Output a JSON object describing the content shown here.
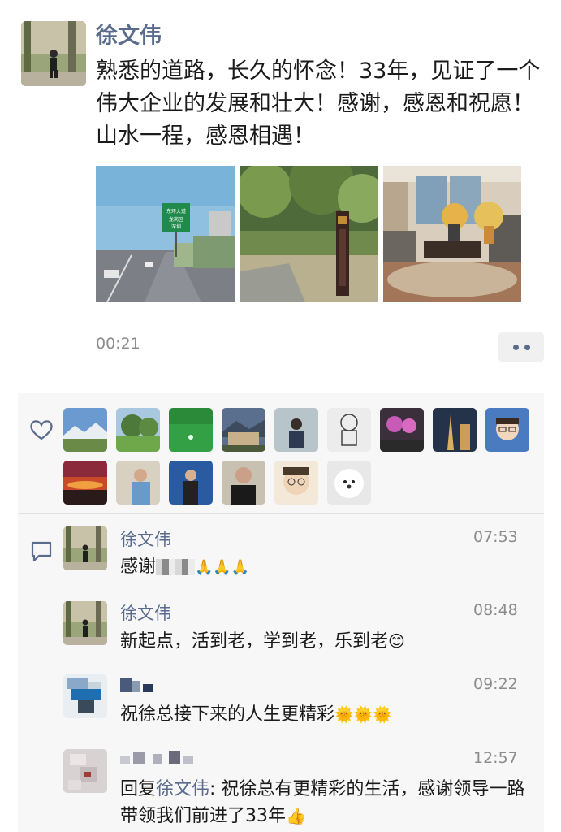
{
  "post": {
    "author": "徐文伟",
    "text": "熟悉的道路，长久的怀念！33年，见证了一个伟大企业的发展和壮大！感谢，感恩和祝愿！山水一程，感恩相遇！",
    "time": "00:21",
    "road_sign_lines": [
      "东环大道",
      "龙岗区",
      "深圳"
    ]
  },
  "comments": [
    {
      "author": "徐文伟",
      "time": "07:53",
      "text": "感谢",
      "emoji": "🙏🙏🙏"
    },
    {
      "author": "徐文伟",
      "time": "08:48",
      "text": "新起点，活到老，学到老，乐到老",
      "emoji": "😊"
    },
    {
      "author": "",
      "time": "09:22",
      "text": "祝徐总接下来的人生更精彩",
      "emoji": "🌞🌞🌞"
    },
    {
      "author": "",
      "time": "12:57",
      "reply_prefix": "回复",
      "reply_to": "徐文伟",
      "text": ": 祝徐总有更精彩的生活，感谢领导一路带领我们前进了33年",
      "emoji": "👍"
    }
  ],
  "colors": {
    "name": "#5a6b8c",
    "panel": "#f7f7f7",
    "time": "#8c8c8c"
  },
  "icons": {
    "like": "heart-outline-icon",
    "comment": "comment-bubble-icon",
    "more": "more-dots-icon"
  }
}
